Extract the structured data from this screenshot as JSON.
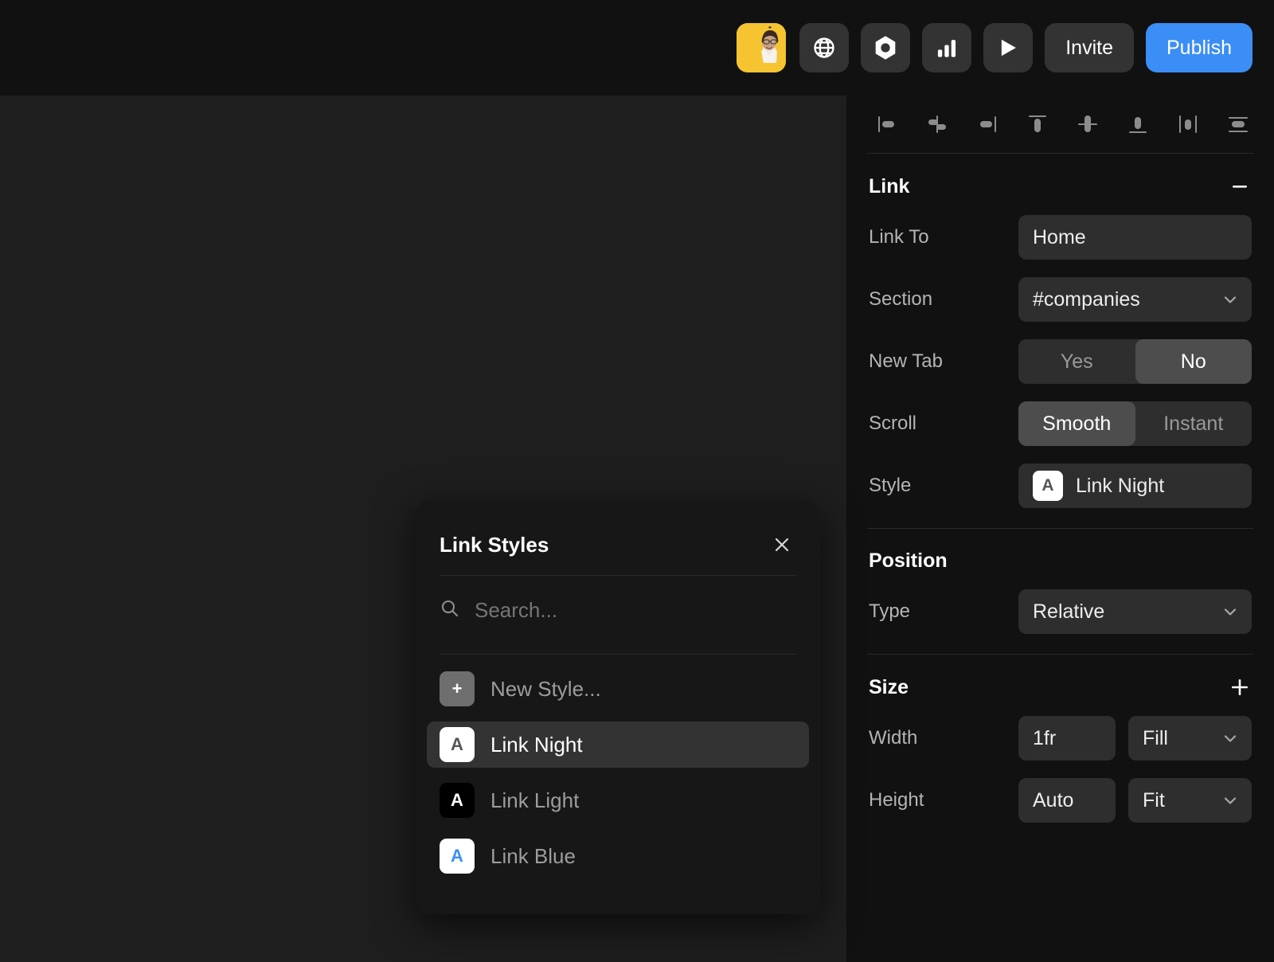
{
  "topbar": {
    "avatar_alt": "user-avatar",
    "icons": [
      {
        "name": "globe-icon"
      },
      {
        "name": "hexagon-icon"
      },
      {
        "name": "bar-chart-icon"
      },
      {
        "name": "play-icon"
      }
    ],
    "invite_label": "Invite",
    "publish_label": "Publish",
    "publish_color": "#3b8ef5"
  },
  "align_toolbar": [
    {
      "name": "align-left-icon"
    },
    {
      "name": "align-center-horizontal-icon"
    },
    {
      "name": "align-right-icon"
    },
    {
      "name": "align-top-icon"
    },
    {
      "name": "align-middle-vertical-icon"
    },
    {
      "name": "align-bottom-icon"
    },
    {
      "name": "distribute-horizontal-icon"
    },
    {
      "name": "distribute-vertical-icon"
    }
  ],
  "link_section": {
    "title": "Link",
    "collapse_glyph": "–",
    "rows": {
      "link_to": {
        "label": "Link To",
        "value": "Home"
      },
      "section": {
        "label": "Section",
        "value": "#companies"
      },
      "new_tab": {
        "label": "New Tab",
        "options": [
          "Yes",
          "No"
        ],
        "selected": "No"
      },
      "scroll": {
        "label": "Scroll",
        "options": [
          "Smooth",
          "Instant"
        ],
        "selected": "Smooth"
      },
      "style": {
        "label": "Style",
        "value": "Link Night",
        "swatch_letter": "A",
        "swatch_bg": "#ffffff",
        "swatch_fg": "#555555"
      }
    }
  },
  "position_section": {
    "title": "Position",
    "rows": {
      "type": {
        "label": "Type",
        "value": "Relative"
      }
    }
  },
  "size_section": {
    "title": "Size",
    "expand_glyph": "+",
    "rows": {
      "width": {
        "label": "Width",
        "value": "1fr",
        "mode": "Fill"
      },
      "height": {
        "label": "Height",
        "value": "Auto",
        "mode": "Fit"
      }
    }
  },
  "dialog": {
    "title": "Link Styles",
    "close_label": "×",
    "search_placeholder": "Search...",
    "search_value": "",
    "items": [
      {
        "label": "New Style...",
        "icon": "plus-icon",
        "swatch_bg": "#6e6e6e",
        "swatch_fg": "#ffffff",
        "letter": "+",
        "selected": false
      },
      {
        "label": "Link Night",
        "icon": "style-swatch-icon",
        "swatch_bg": "#ffffff",
        "swatch_fg": "#555555",
        "letter": "A",
        "selected": true
      },
      {
        "label": "Link Light",
        "icon": "style-swatch-icon",
        "swatch_bg": "#000000",
        "swatch_fg": "#ffffff",
        "letter": "A",
        "selected": false
      },
      {
        "label": "Link Blue",
        "icon": "style-swatch-icon",
        "swatch_bg": "#ffffff",
        "swatch_fg": "#3b8ef5",
        "letter": "A",
        "selected": false
      }
    ]
  }
}
